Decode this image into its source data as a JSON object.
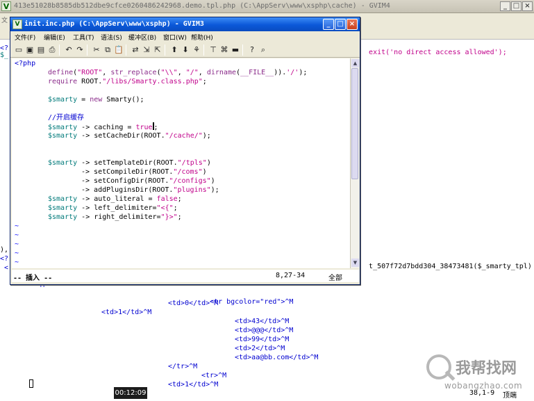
{
  "bg_window": {
    "title": "413e51028b8585db512dbe9cfce0260486242968.demo.tpl.php (C:\\AppServ\\www\\xsphp\\cache) - GVIM4",
    "menu_first": "文"
  },
  "bg_code": {
    "exit_line": "exit('no direct access allowed');",
    "smarty_tpl_line": "t_507f72d7bdd304_38473481($_smarty_tpl)",
    "left_frags": [
      "<?",
      "$_",
      "),",
      "<?",
      " <"
    ],
    "html_lines": [
      "^M",
      "<tr bgcolor=\"red\">^M",
      "<td>0</td>^M",
      "<td>1</td>^M",
      "<td>43</td>^M",
      "<td>@@@</td>^M",
      "<td>99</td>^M",
      "<td>2</td>^M",
      "<td>aa@bb.com</td>^M",
      "</tr>^M",
      "<tr>^M",
      "<td>1</td>^M"
    ],
    "status_pos": "38,1-9",
    "status_extra": "顶端"
  },
  "fg_window": {
    "title": "init.inc.php (C:\\AppServ\\www\\xsphp) - GVIM3",
    "menus": [
      "文件(F)",
      "编辑(E)",
      "工具(T)",
      "语法(S)",
      "缓冲区(B)",
      "窗口(W)",
      "帮助(H)"
    ],
    "code_lines": [
      "<?php",
      "define(\"ROOT\", str_replace(\"\\\\\", \"/\", dirname(__FILE__)).'/');",
      "require ROOT.\"/libs/Smarty.class.php\";",
      "",
      "$smarty = new Smarty();",
      "",
      "//开启缓存",
      "$smarty -> caching = true;",
      "$smarty -> setCacheDir(ROOT.\"/cache/\");",
      "",
      "",
      "$smarty -> setTemplateDir(ROOT.\"/tpls\")",
      "-> setCompileDir(ROOT.\"/coms\")",
      "-> setConfigDir(ROOT.\"/configs\")",
      "-> addPluginsDir(ROOT.\"plugins\");",
      "$smarty -> auto_literal = false;",
      "$smarty -> left_delimiter=\"<{\";",
      "$smarty -> right_delimiter=\"}>\";"
    ],
    "status_mode": "-- 插入 --",
    "status_pos": "8,27-34",
    "status_all": "全部"
  },
  "video_time": "00:12:09",
  "watermark": {
    "text": "我帮找网",
    "url": "wobangzhao.com"
  },
  "colors": {
    "title_active": "#0b58d8",
    "keyword": "#8a2b8a",
    "string": "#c0008a",
    "variable": "#007a7a",
    "comment": "#0000d0"
  }
}
